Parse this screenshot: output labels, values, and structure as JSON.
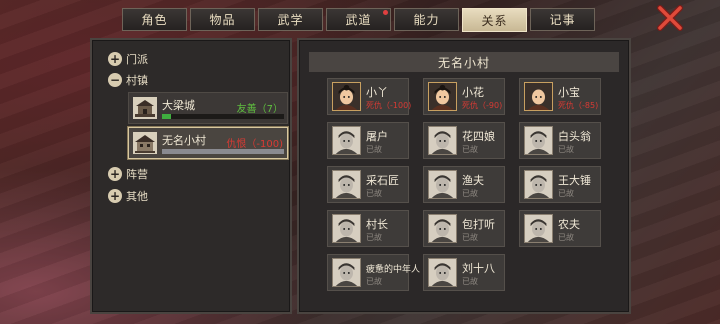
{
  "tabs": [
    {
      "label": "角色",
      "active": false,
      "badge": false
    },
    {
      "label": "物品",
      "active": false,
      "badge": false
    },
    {
      "label": "武学",
      "active": false,
      "badge": false
    },
    {
      "label": "武道",
      "active": false,
      "badge": true
    },
    {
      "label": "能力",
      "active": false,
      "badge": false
    },
    {
      "label": "关系",
      "active": true,
      "badge": false
    },
    {
      "label": "记事",
      "active": false,
      "badge": false
    }
  ],
  "close_icon": "close-x-icon",
  "tree": {
    "sect": {
      "label": "门派",
      "toggle": "+"
    },
    "town": {
      "label": "村镇",
      "toggle": "−"
    },
    "camp": {
      "label": "阵营",
      "toggle": "+"
    },
    "other": {
      "label": "其他",
      "toggle": "+"
    }
  },
  "places": [
    {
      "name": "大梁城",
      "relation": "友善（7）",
      "relation_color": "#5fbf3f",
      "bar_fraction": 0.07,
      "bar_color": "#3fae3f",
      "icon": "city-gate-icon"
    },
    {
      "name": "无名小村",
      "relation": "仇恨（-100)",
      "relation_color": "#d83a34",
      "bar_fraction": 1.0,
      "bar_color": "#8a8a90",
      "icon": "village-house-icon"
    }
  ],
  "right": {
    "title": "无名小村",
    "characters": [
      {
        "name": "小丫",
        "status": "死仇（-100)",
        "enemy": true,
        "portrait": "girl-portrait-icon"
      },
      {
        "name": "小花",
        "status": "死仇（-90)",
        "enemy": true,
        "portrait": "girl-portrait-icon"
      },
      {
        "name": "小宝",
        "status": "死仇（-85)",
        "enemy": true,
        "portrait": "bald-boy-portrait-icon"
      },
      {
        "name": "屠户",
        "status": "已故",
        "enemy": false,
        "portrait": "man-portrait-icon"
      },
      {
        "name": "花四娘",
        "status": "已故",
        "enemy": false,
        "portrait": "woman-portrait-icon"
      },
      {
        "name": "白头翁",
        "status": "已故",
        "enemy": false,
        "portrait": "old-man-portrait-icon"
      },
      {
        "name": "采石匠",
        "status": "已故",
        "enemy": false,
        "portrait": "man-portrait-icon"
      },
      {
        "name": "渔夫",
        "status": "已故",
        "enemy": false,
        "portrait": "man-portrait-icon"
      },
      {
        "name": "王大锤",
        "status": "已故",
        "enemy": false,
        "portrait": "man-portrait-icon"
      },
      {
        "name": "村长",
        "status": "已故",
        "enemy": false,
        "portrait": "old-man-portrait-icon"
      },
      {
        "name": "包打听",
        "status": "已故",
        "enemy": false,
        "portrait": "man-portrait-icon"
      },
      {
        "name": "农夫",
        "status": "已故",
        "enemy": false,
        "portrait": "man-portrait-icon"
      },
      {
        "name": "疲惫的中年人",
        "status": "已故",
        "enemy": false,
        "portrait": "man-portrait-icon"
      },
      {
        "name": "刘十八",
        "status": "已故",
        "enemy": false,
        "portrait": "man-portrait-icon"
      }
    ]
  }
}
